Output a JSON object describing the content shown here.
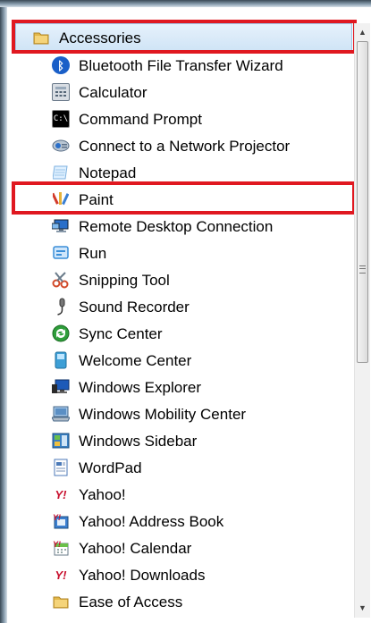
{
  "menu": {
    "folder": {
      "label": "Accessories",
      "icon": "folder-icon"
    },
    "items": [
      {
        "label": "Bluetooth File Transfer Wizard",
        "icon": "bluetooth-icon",
        "color": "#1a5fc8"
      },
      {
        "label": "Calculator",
        "icon": "calculator-icon",
        "color": "#6b7a8a"
      },
      {
        "label": "Command Prompt",
        "icon": "command-prompt-icon",
        "color": "#000000"
      },
      {
        "label": "Connect to a Network Projector",
        "icon": "network-projector-icon",
        "color": "#5a6f86"
      },
      {
        "label": "Notepad",
        "icon": "notepad-icon",
        "color": "#7fb2e0"
      },
      {
        "label": "Paint",
        "icon": "paint-icon",
        "color": "#c8962e"
      },
      {
        "label": "Remote Desktop Connection",
        "icon": "remote-desktop-icon",
        "color": "#2a6fc9"
      },
      {
        "label": "Run",
        "icon": "run-icon",
        "color": "#3a8ed8"
      },
      {
        "label": "Snipping Tool",
        "icon": "snipping-tool-icon",
        "color": "#d24a2a"
      },
      {
        "label": "Sound Recorder",
        "icon": "sound-recorder-icon",
        "color": "#555555"
      },
      {
        "label": "Sync Center",
        "icon": "sync-center-icon",
        "color": "#2e9e3a"
      },
      {
        "label": "Welcome Center",
        "icon": "welcome-center-icon",
        "color": "#3d9fd6"
      },
      {
        "label": "Windows Explorer",
        "icon": "windows-explorer-icon",
        "color": "#1d5ab8"
      },
      {
        "label": "Windows Mobility Center",
        "icon": "mobility-center-icon",
        "color": "#4a6a8a"
      },
      {
        "label": "Windows Sidebar",
        "icon": "windows-sidebar-icon",
        "color": "#3a7fc2"
      },
      {
        "label": "WordPad",
        "icon": "wordpad-icon",
        "color": "#4c7ab8"
      },
      {
        "label": "Yahoo!",
        "icon": "yahoo-icon",
        "color": "#c8102e"
      },
      {
        "label": "Yahoo! Address Book",
        "icon": "yahoo-address-book-icon",
        "color": "#c8102e"
      },
      {
        "label": "Yahoo! Calendar",
        "icon": "yahoo-calendar-icon",
        "color": "#c8102e"
      },
      {
        "label": "Yahoo! Downloads",
        "icon": "yahoo-downloads-icon",
        "color": "#c8102e"
      }
    ],
    "bottom_folder": {
      "label": "Ease of Access",
      "icon": "folder-icon"
    }
  },
  "highlight_color": "#e01820",
  "selected_item": "Paint"
}
